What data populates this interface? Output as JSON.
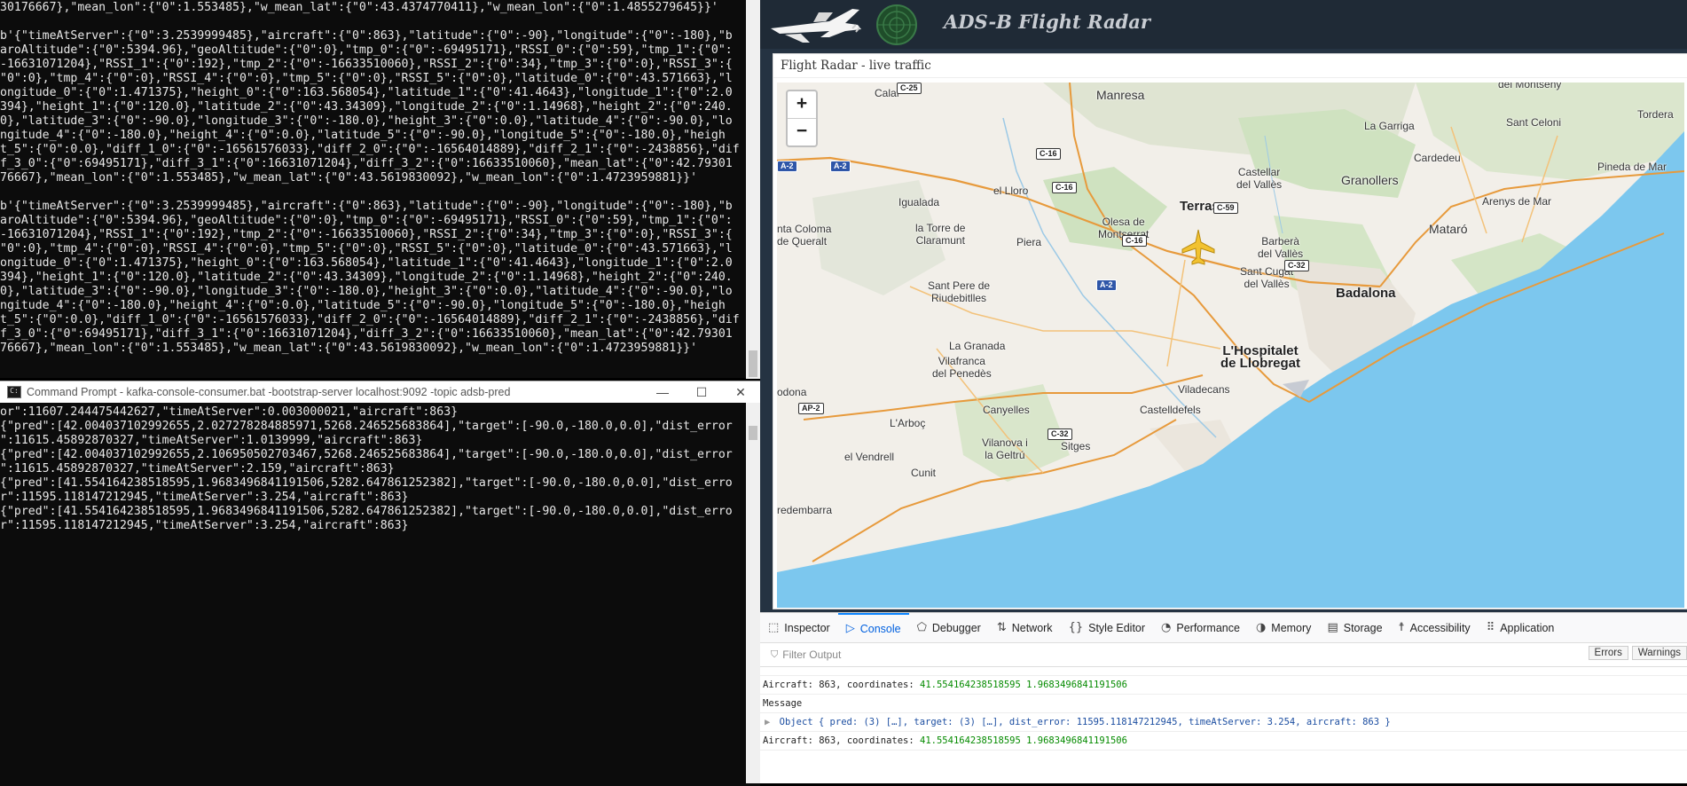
{
  "terminal_top": {
    "lines": [
      "30176667},\"mean_lon\":{\"0\":1.553485},\"w_mean_lat\":{\"0\":43.4374770411},\"w_mean_lon\":{\"0\":1.4855279645}}'",
      "",
      "b'{\"timeAtServer\":{\"0\":3.2539999485},\"aircraft\":{\"0\":863},\"latitude\":{\"0\":-90},\"longitude\":{\"0\":-180},\"b",
      "aroAltitude\":{\"0\":5394.96},\"geoAltitude\":{\"0\":0},\"tmp_0\":{\"0\":-69495171},\"RSSI_0\":{\"0\":59},\"tmp_1\":{\"0\":",
      "-16631071204},\"RSSI_1\":{\"0\":192},\"tmp_2\":{\"0\":-16633510060},\"RSSI_2\":{\"0\":34},\"tmp_3\":{\"0\":0},\"RSSI_3\":{",
      "\"0\":0},\"tmp_4\":{\"0\":0},\"RSSI_4\":{\"0\":0},\"tmp_5\":{\"0\":0},\"RSSI_5\":{\"0\":0},\"latitude_0\":{\"0\":43.571663},\"l",
      "ongitude_0\":{\"0\":1.471375},\"height_0\":{\"0\":163.568054},\"latitude_1\":{\"0\":41.4643},\"longitude_1\":{\"0\":2.0",
      "394},\"height_1\":{\"0\":120.0},\"latitude_2\":{\"0\":43.34309},\"longitude_2\":{\"0\":1.14968},\"height_2\":{\"0\":240.",
      "0},\"latitude_3\":{\"0\":-90.0},\"longitude_3\":{\"0\":-180.0},\"height_3\":{\"0\":0.0},\"latitude_4\":{\"0\":-90.0},\"lo",
      "ngitude_4\":{\"0\":-180.0},\"height_4\":{\"0\":0.0},\"latitude_5\":{\"0\":-90.0},\"longitude_5\":{\"0\":-180.0},\"heigh",
      "t_5\":{\"0\":0.0},\"diff_1_0\":{\"0\":-16561576033},\"diff_2_0\":{\"0\":-16564014889},\"diff_2_1\":{\"0\":-2438856},\"dif",
      "f_3_0\":{\"0\":69495171},\"diff_3_1\":{\"0\":16631071204},\"diff_3_2\":{\"0\":16633510060},\"mean_lat\":{\"0\":42.79301",
      "76667},\"mean_lon\":{\"0\":1.553485},\"w_mean_lat\":{\"0\":43.5619830092},\"w_mean_lon\":{\"0\":1.4723959881}}'",
      "",
      "b'{\"timeAtServer\":{\"0\":3.2539999485},\"aircraft\":{\"0\":863},\"latitude\":{\"0\":-90},\"longitude\":{\"0\":-180},\"b",
      "aroAltitude\":{\"0\":5394.96},\"geoAltitude\":{\"0\":0},\"tmp_0\":{\"0\":-69495171},\"RSSI_0\":{\"0\":59},\"tmp_1\":{\"0\":",
      "-16631071204},\"RSSI_1\":{\"0\":192},\"tmp_2\":{\"0\":-16633510060},\"RSSI_2\":{\"0\":34},\"tmp_3\":{\"0\":0},\"RSSI_3\":{",
      "\"0\":0},\"tmp_4\":{\"0\":0},\"RSSI_4\":{\"0\":0},\"tmp_5\":{\"0\":0},\"RSSI_5\":{\"0\":0},\"latitude_0\":{\"0\":43.571663},\"l",
      "ongitude_0\":{\"0\":1.471375},\"height_0\":{\"0\":163.568054},\"latitude_1\":{\"0\":41.4643},\"longitude_1\":{\"0\":2.0",
      "394},\"height_1\":{\"0\":120.0},\"latitude_2\":{\"0\":43.34309},\"longitude_2\":{\"0\":1.14968},\"height_2\":{\"0\":240.",
      "0},\"latitude_3\":{\"0\":-90.0},\"longitude_3\":{\"0\":-180.0},\"height_3\":{\"0\":0.0},\"latitude_4\":{\"0\":-90.0},\"lo",
      "ngitude_4\":{\"0\":-180.0},\"height_4\":{\"0\":0.0},\"latitude_5\":{\"0\":-90.0},\"longitude_5\":{\"0\":-180.0},\"heigh",
      "t_5\":{\"0\":0.0},\"diff_1_0\":{\"0\":-16561576033},\"diff_2_0\":{\"0\":-16564014889},\"diff_2_1\":{\"0\":-2438856},\"dif",
      "f_3_0\":{\"0\":69495171},\"diff_3_1\":{\"0\":16631071204},\"diff_3_2\":{\"0\":16633510060},\"mean_lat\":{\"0\":42.79301",
      "76667},\"mean_lon\":{\"0\":1.553485},\"w_mean_lat\":{\"0\":43.5619830092},\"w_mean_lon\":{\"0\":1.4723959881}}'"
    ]
  },
  "consumer_window": {
    "title": "Command Prompt - kafka-console-consumer.bat  -bootstrap-server localhost:9092 -topic adsb-pred",
    "lines": [
      "or\":11607.244475442627,\"timeAtServer\":0.003000021,\"aircraft\":863}",
      "{\"pred\":[42.004037102992655,2.027278284885971,5268.246525683864],\"target\":[-90.0,-180.0,0.0],\"dist_error",
      "\":11615.45892870327,\"timeAtServer\":1.0139999,\"aircraft\":863}",
      "{\"pred\":[42.004037102992655,2.106950502703467,5268.246525683864],\"target\":[-90.0,-180.0,0.0],\"dist_error",
      "\":11615.45892870327,\"timeAtServer\":2.159,\"aircraft\":863}",
      "{\"pred\":[41.554164238518595,1.9683496841191506,5282.647861252382],\"target\":[-90.0,-180.0,0.0],\"dist_erro",
      "r\":11595.118147212945,\"timeAtServer\":3.254,\"aircraft\":863}",
      "{\"pred\":[41.554164238518595,1.9683496841191506,5282.647861252382],\"target\":[-90.0,-180.0,0.0],\"dist_erro",
      "r\":11595.118147212945,\"timeAtServer\":3.254,\"aircraft\":863}"
    ]
  },
  "app": {
    "title": "ADS-B Flight Radar",
    "panel_title": "Flight Radar - live traffic"
  },
  "map": {
    "zoom_in": "+",
    "zoom_out": "−",
    "places": {
      "calaf": "Calaf",
      "manresa": "Manresa",
      "monseny": "del Montseny",
      "tordera": "Tordera",
      "la_garriga": "La Garriga",
      "sant_celoni": "Sant Celoni",
      "cardedeu": "Cardedeu",
      "pineda": "Pineda de Mar",
      "castellar": "Castellar\ndel Vallès",
      "granollers": "Granollers",
      "igualada": "Igualada",
      "el_lloro": "el Lloro",
      "terrassa": "Terrassa",
      "arenys": "Arenys de Mar",
      "santa_coloma": "nta Coloma\nde Queralt",
      "torre": "la Torre de\nClaramunt",
      "olesa": "Olesa de\nMontserrat",
      "barbera": "Barberà\ndel Vallès",
      "mataro": "Mataró",
      "piera": "Piera",
      "sant_cugat": "Sant Cugat\ndel Vallès",
      "sant_pere": "Sant Pere de\nRiudebitlles",
      "badalona": "Badalona",
      "la_granada": "La Granada",
      "hospitalet": "L'Hospitalet\nde Llobregat",
      "vilafranca": "Vilafranca\ndel Penedès",
      "viladecans": "Viladecans",
      "odona": "odona",
      "canyelles": "Canyelles",
      "arboc": "L'Arboç",
      "castelldefels": "Castelldefels",
      "vilanova": "Vilanova i\nla Geltrú",
      "sitges": "Sitges",
      "vendrell": "el Vendrell",
      "cunit": "Cunit",
      "redembarra": "redembarra"
    },
    "roads": {
      "c25": "C-25",
      "a2_west": "A-2",
      "a2_a": "A-2",
      "c16_a": "C-16",
      "c16_b": "C-16",
      "c16_c": "C-16",
      "c59": "C-59",
      "a2_b": "A-2",
      "c32_a": "C-32",
      "ap2": "AP-2",
      "c32_b": "C-32"
    },
    "aircraft_marker": "airplane-icon"
  },
  "devtools": {
    "tabs": [
      {
        "label": "Inspector",
        "icon": "inspector-icon"
      },
      {
        "label": "Console",
        "icon": "console-icon"
      },
      {
        "label": "Debugger",
        "icon": "debugger-icon"
      },
      {
        "label": "Network",
        "icon": "network-icon"
      },
      {
        "label": "Style Editor",
        "icon": "style-editor-icon"
      },
      {
        "label": "Performance",
        "icon": "performance-icon"
      },
      {
        "label": "Memory",
        "icon": "memory-icon"
      },
      {
        "label": "Storage",
        "icon": "storage-icon"
      },
      {
        "label": "Accessibility",
        "icon": "accessibility-icon"
      },
      {
        "label": "Application",
        "icon": "application-icon"
      }
    ],
    "active_tab": "Console",
    "filter_placeholder": "Filter Output",
    "filter_buttons": [
      "Errors",
      "Warnings"
    ],
    "log": {
      "row1_label": "Aircraft: 863, coordinates: ",
      "row1_lat": "41.554164238518595",
      "row1_lon": "1.9683496841191506",
      "row2": "Message",
      "row3_toggle": "▶",
      "row3": "Object { pred: (3) […], target: (3) […], dist_error: 11595.118147212945, timeAtServer: 3.254, aircraft: 863 }",
      "row4_label": "Aircraft: 863, coordinates: ",
      "row4_lat": "41.554164238518595",
      "row4_lon": "1.9683496841191506"
    }
  },
  "colors": {
    "accent": "#0a84ff",
    "header_bg": "#1f2a36",
    "sea": "#7cc7ee",
    "land": "#f2efe9"
  }
}
